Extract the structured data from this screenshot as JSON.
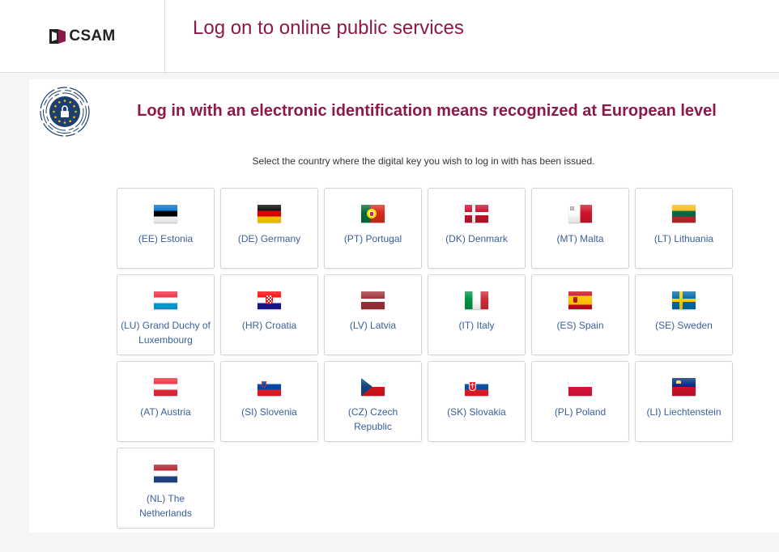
{
  "header": {
    "logo_text": "CSAM",
    "title": "Log on to online public services"
  },
  "panel": {
    "title": "Log in with an electronic identification means recognized at European level",
    "instruction": "Select the country where the digital key you wish to log in with has been issued."
  },
  "countries": [
    {
      "label": "(EE) Estonia",
      "code": "ee"
    },
    {
      "label": "(DE) Germany",
      "code": "de"
    },
    {
      "label": "(PT) Portugal",
      "code": "pt"
    },
    {
      "label": "(DK) Denmark",
      "code": "dk"
    },
    {
      "label": "(MT) Malta",
      "code": "mt"
    },
    {
      "label": "(LT) Lithuania",
      "code": "lt"
    },
    {
      "label": "(LU) Grand Duchy of Luxembourg",
      "code": "lu"
    },
    {
      "label": "(HR) Croatia",
      "code": "hr"
    },
    {
      "label": "(LV) Latvia",
      "code": "lv"
    },
    {
      "label": "(IT) Italy",
      "code": "it"
    },
    {
      "label": "(ES) Spain",
      "code": "es"
    },
    {
      "label": "(SE) Sweden",
      "code": "se"
    },
    {
      "label": "(AT) Austria",
      "code": "at"
    },
    {
      "label": "(SI) Slovenia",
      "code": "si"
    },
    {
      "label": "(CZ) Czech Republic",
      "code": "cz"
    },
    {
      "label": "(SK) Slovakia",
      "code": "sk"
    },
    {
      "label": "(PL) Poland",
      "code": "pl"
    },
    {
      "label": "(LI) Liechtenstein",
      "code": "li"
    },
    {
      "label": "(NL) The Netherlands",
      "code": "nl"
    }
  ],
  "colors": {
    "accent": "#8b1a4a",
    "link": "#3a5f9a"
  }
}
